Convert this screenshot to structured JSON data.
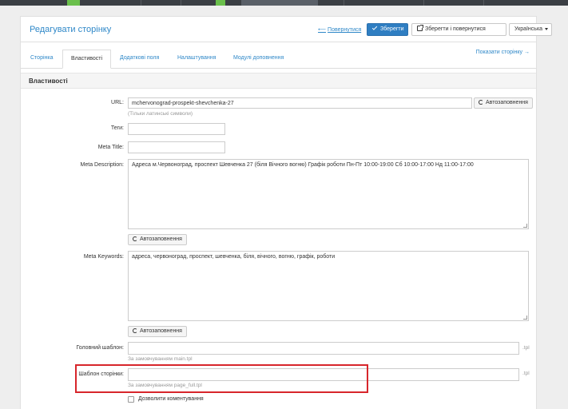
{
  "header": {
    "title": "Редагувати сторінку",
    "back_link": "Повернутися",
    "save": "Зберегти",
    "save_and_return": "Зберегти і повернутися",
    "language": "Українська"
  },
  "tabs": [
    {
      "label": "Сторінка",
      "active": false
    },
    {
      "label": "Властивості",
      "active": true
    },
    {
      "label": "Додаткові поля",
      "active": false
    },
    {
      "label": "Налаштування",
      "active": false
    },
    {
      "label": "Модулі доповнення",
      "active": false
    }
  ],
  "show_page_link": "Показати сторінку →",
  "section_title": "Властивості",
  "autofill_label": "Автозаповнення",
  "fields": {
    "url": {
      "label": "URL:",
      "value": "mchervonograd-prospekt-shevchenka-27",
      "help": "(Тільки латинські символи)"
    },
    "tags": {
      "label": "Теги:",
      "value": ""
    },
    "meta_title": {
      "label": "Meta Title:",
      "value": ""
    },
    "meta_description": {
      "label": "Meta Description:",
      "value": "Адреса м.Червоноград, проспект Шевченка 27 (біля Вічного вогню) Графік роботи Пн-Пт 10:00-19:00 Сб 10:00-17:00 Нд 11:00-17:00"
    },
    "meta_keywords": {
      "label": "Meta Keywords:",
      "value": "адреса, червоноград, проспект, шевченка, біля, вічного, вогню, графік, роботи"
    },
    "main_template": {
      "label": "Головний шаблон:",
      "value": "",
      "help": "За замовчуванням main.tpl",
      "ext": ".tpl"
    },
    "page_template": {
      "label": "Шаблон сторінки:",
      "value": "",
      "help": "За замовчуванням page_full.tpl",
      "ext": ".tpl"
    },
    "allow_comments": {
      "label": "Дозволити коментування",
      "checked": false
    }
  }
}
